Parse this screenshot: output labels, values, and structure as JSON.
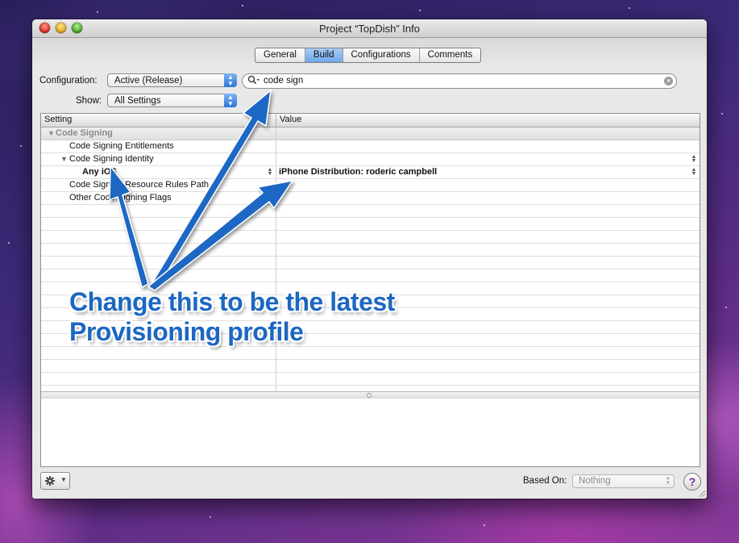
{
  "window": {
    "title": "Project “TopDish” Info"
  },
  "tabs": [
    {
      "label": "General",
      "active": false
    },
    {
      "label": "Build",
      "active": true
    },
    {
      "label": "Configurations",
      "active": false
    },
    {
      "label": "Comments",
      "active": false
    }
  ],
  "configuration": {
    "label": "Configuration:",
    "value": "Active (Release)"
  },
  "show": {
    "label": "Show:",
    "value": "All Settings"
  },
  "search": {
    "value": "code sign",
    "icon": "magnifier-icon"
  },
  "table": {
    "headers": {
      "setting": "Setting",
      "value": "Value"
    },
    "rows": [
      {
        "setting": "Code Signing",
        "value": "",
        "kind": "group",
        "expanded": true
      },
      {
        "setting": "Code Signing Entitlements",
        "value": "",
        "kind": "item"
      },
      {
        "setting": "Code Signing Identity",
        "value": "",
        "kind": "parent",
        "expanded": true
      },
      {
        "setting": "Any iOS",
        "value": "iPhone Distribution: roderic campbell",
        "kind": "child",
        "bold": true
      },
      {
        "setting": "Code Signing Resource Rules Path",
        "value": "",
        "kind": "item"
      },
      {
        "setting": "Other Code Signing Flags",
        "value": "",
        "kind": "item"
      }
    ]
  },
  "footer": {
    "based_on_label": "Based On:",
    "based_on_value": "Nothing",
    "help_label": "?"
  },
  "annotation": {
    "line1": "Change this to be the latest",
    "line2": "Provisioning profile",
    "color": "#1c67c2"
  }
}
